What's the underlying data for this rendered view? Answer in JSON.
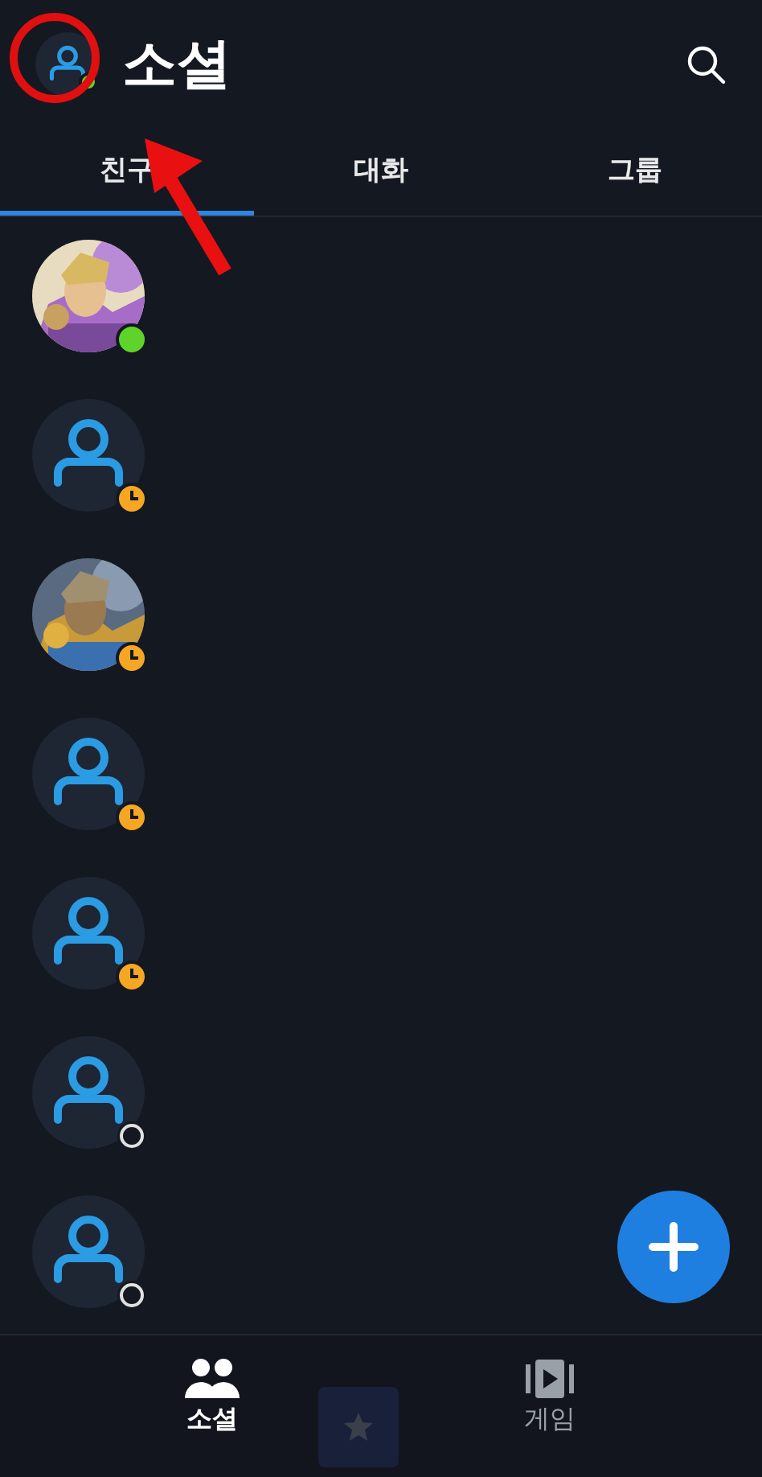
{
  "header": {
    "title": "소셜",
    "status": {
      "kind": "online"
    }
  },
  "tabs": [
    {
      "label": "친구",
      "selected": true
    },
    {
      "label": "대화",
      "selected": false
    },
    {
      "label": "그룹",
      "selected": false
    }
  ],
  "friends": [
    {
      "kind": "picture",
      "status": {
        "kind": "online"
      }
    },
    {
      "kind": "default",
      "status": {
        "kind": "away"
      }
    },
    {
      "kind": "picture",
      "status": {
        "kind": "away"
      }
    },
    {
      "kind": "default",
      "status": {
        "kind": "away"
      }
    },
    {
      "kind": "default",
      "status": {
        "kind": "away"
      }
    },
    {
      "kind": "default",
      "status": {
        "kind": "offline"
      }
    },
    {
      "kind": "default",
      "status": {
        "kind": "offline"
      }
    }
  ],
  "bottom_nav": [
    {
      "label": "소셜",
      "kind": "social",
      "selected": true
    },
    {
      "label": "게임",
      "kind": "games",
      "selected": false
    }
  ]
}
